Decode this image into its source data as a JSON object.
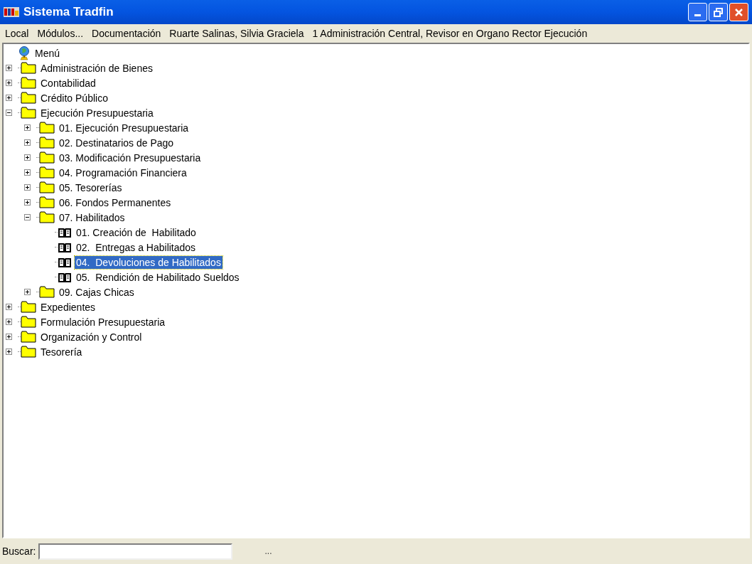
{
  "window": {
    "title": "Sistema Tradfin"
  },
  "menu_bar": [
    "Local",
    "Módulos...",
    "Documentación",
    "Ruarte Salinas, Silvia Graciela",
    "1 Administración Central, Revisor en Organo Rector Ejecución"
  ],
  "tree": {
    "label": "Menú",
    "kind": "root",
    "selected": false,
    "children": [
      {
        "label": "Administración de Bienes",
        "kind": "folder",
        "expanded": false,
        "selected": false
      },
      {
        "label": "Contabilidad",
        "kind": "folder",
        "expanded": false,
        "selected": false
      },
      {
        "label": "Crédito Público",
        "kind": "folder",
        "expanded": false,
        "selected": false
      },
      {
        "label": "Ejecución Presupuestaria",
        "kind": "folder",
        "expanded": true,
        "selected": false,
        "children": [
          {
            "label": "01. Ejecución Presupuestaria",
            "kind": "folder",
            "expanded": false,
            "selected": false
          },
          {
            "label": "02. Destinatarios de Pago",
            "kind": "folder",
            "expanded": false,
            "selected": false
          },
          {
            "label": "03. Modificación Presupuestaria",
            "kind": "folder",
            "expanded": false,
            "selected": false
          },
          {
            "label": "04. Programación Financiera",
            "kind": "folder",
            "expanded": false,
            "selected": false
          },
          {
            "label": "05. Tesorerías",
            "kind": "folder",
            "expanded": false,
            "selected": false
          },
          {
            "label": "06. Fondos Permanentes",
            "kind": "folder",
            "expanded": false,
            "selected": false
          },
          {
            "label": "07. Habilitados",
            "kind": "folder",
            "expanded": true,
            "selected": false,
            "children": [
              {
                "label": "01. Creación de  Habilitado",
                "kind": "leaf",
                "selected": false
              },
              {
                "label": "02.  Entregas a Habilitados",
                "kind": "leaf",
                "selected": false
              },
              {
                "label": "04.  Devoluciones de Habilitados",
                "kind": "leaf",
                "selected": true
              },
              {
                "label": "05.  Rendición de Habilitado Sueldos",
                "kind": "leaf",
                "selected": false
              }
            ]
          },
          {
            "label": "09. Cajas Chicas",
            "kind": "folder",
            "expanded": false,
            "selected": false
          }
        ]
      },
      {
        "label": "Expedientes",
        "kind": "folder",
        "expanded": false,
        "selected": false
      },
      {
        "label": "Formulación Presupuestaria",
        "kind": "folder",
        "expanded": false,
        "selected": false
      },
      {
        "label": "Organización y Control",
        "kind": "folder",
        "expanded": false,
        "selected": false
      },
      {
        "label": "Tesorería",
        "kind": "folder",
        "expanded": false,
        "selected": false
      }
    ]
  },
  "search": {
    "label": "Buscar:"
  },
  "status_text": "..."
}
